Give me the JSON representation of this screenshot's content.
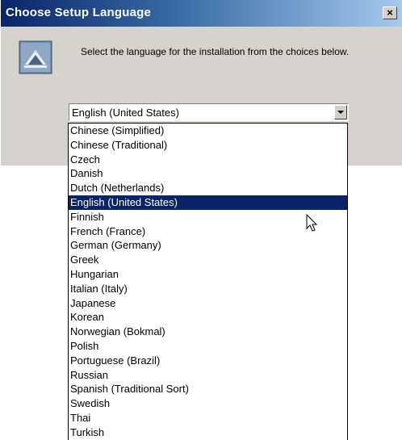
{
  "dialog": {
    "title": "Choose Setup Language",
    "close_label": "×",
    "prompt": "Select the language for the installation from the choices below.",
    "icon": "setup-icon"
  },
  "combo": {
    "selected": "English (United States)"
  },
  "languages": [
    "Chinese (Simplified)",
    "Chinese (Traditional)",
    "Czech",
    "Danish",
    "Dutch (Netherlands)",
    "English (United States)",
    "Finnish",
    "French (France)",
    "German (Germany)",
    "Greek",
    "Hungarian",
    "Italian (Italy)",
    "Japanese",
    "Korean",
    "Norwegian (Bokmal)",
    "Polish",
    "Portuguese (Brazil)",
    "Russian",
    "Spanish (Traditional Sort)",
    "Swedish",
    "Thai",
    "Turkish"
  ],
  "highlighted": "English (United States)",
  "colors": {
    "selection": "#0a246a",
    "dialog_bg": "#d5d3cc"
  }
}
